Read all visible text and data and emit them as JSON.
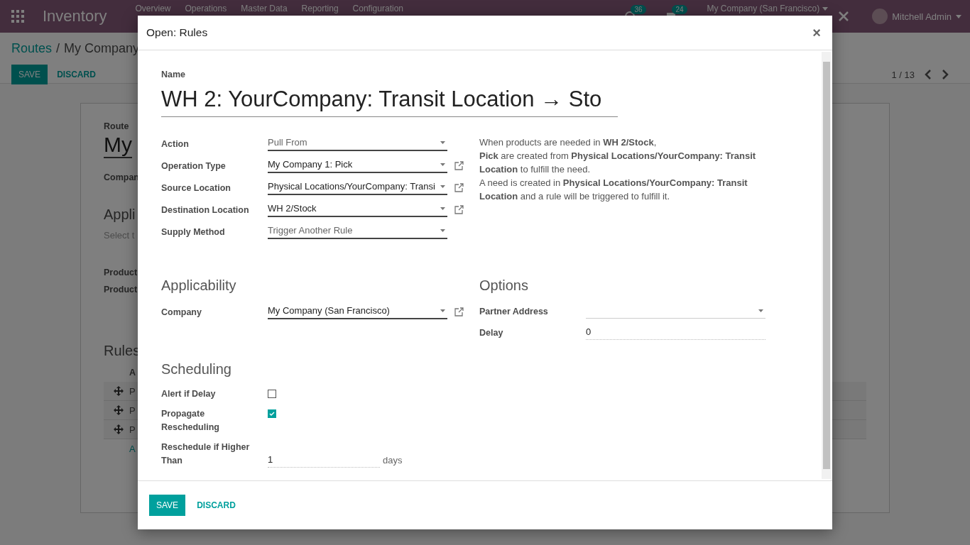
{
  "navbar": {
    "app_name": "Inventory",
    "menu": [
      "Overview",
      "Operations",
      "Master Data",
      "Reporting",
      "Configuration"
    ],
    "activity_count": "36",
    "message_count": "24",
    "company": "My Company (San Francisco)",
    "user": "Mitchell Admin"
  },
  "breadcrumb": [
    "Routes",
    "/",
    "My Company"
  ],
  "control_buttons": [
    "SAVE",
    "DISCARD"
  ],
  "pager": "1 / 13",
  "route_form": {
    "route_label": "Route",
    "route_name": "My",
    "company_label": "Compan",
    "applicability_title": "Appli",
    "applicability_hint": "Select t",
    "product_labels": [
      "Product",
      "Product"
    ],
    "rules_title": "Rules",
    "rules_header": "A",
    "rule_rows": [
      "P",
      "P",
      "P"
    ],
    "add_line": "A"
  },
  "dialog": {
    "title": "Open: Rules",
    "close": "×",
    "name_label": "Name",
    "name_value": "WH 2: YourCompany: Transit Location → Sto",
    "fields": [
      {
        "label": "Action",
        "value": "Pull From",
        "kind": "selection",
        "link": false
      },
      {
        "label": "Operation Type",
        "value": "My Company 1: Pick",
        "kind": "many2one",
        "link": true
      },
      {
        "label": "Source Location",
        "value": "Physical Locations/YourCompany: Transi",
        "kind": "many2one",
        "link": true
      },
      {
        "label": "Destination Location",
        "value": "WH 2/Stock",
        "kind": "many2one",
        "link": true
      },
      {
        "label": "Supply Method",
        "value": "Trigger Another Rule",
        "kind": "selection",
        "link": false
      }
    ],
    "help": [
      "When products are needed in **WH 2/Stock**,",
      "**Pick** are created from **Physical Locations/YourCompany: Transit Location** to fulfill the need.",
      "A need is created in **Physical Locations/YourCompany: Transit Location** and a rule will be triggered to fulfill it."
    ],
    "applicability": {
      "title": "Applicability",
      "fields": [
        {
          "label": "Company",
          "value": "My Company (San Francisco)",
          "kind": "many2one",
          "link": true
        }
      ]
    },
    "options": {
      "title": "Options",
      "fields": [
        {
          "label": "Partner Address",
          "kind": "many2one",
          "link": false
        },
        {
          "label": "Delay",
          "value": "0",
          "kind": "input"
        }
      ]
    },
    "scheduling": {
      "title": "Scheduling",
      "fields": [
        {
          "label": "Alert if Delay",
          "kind": "checkbox",
          "checked": false
        },
        {
          "label": "Propagate Rescheduling",
          "kind": "checkbox",
          "checked": true
        },
        {
          "label": "Reschedule if Higher Than",
          "kind": "input",
          "value": "1",
          "unit": "days"
        }
      ]
    },
    "footer_buttons": [
      "SAVE",
      "DISCARD"
    ]
  }
}
